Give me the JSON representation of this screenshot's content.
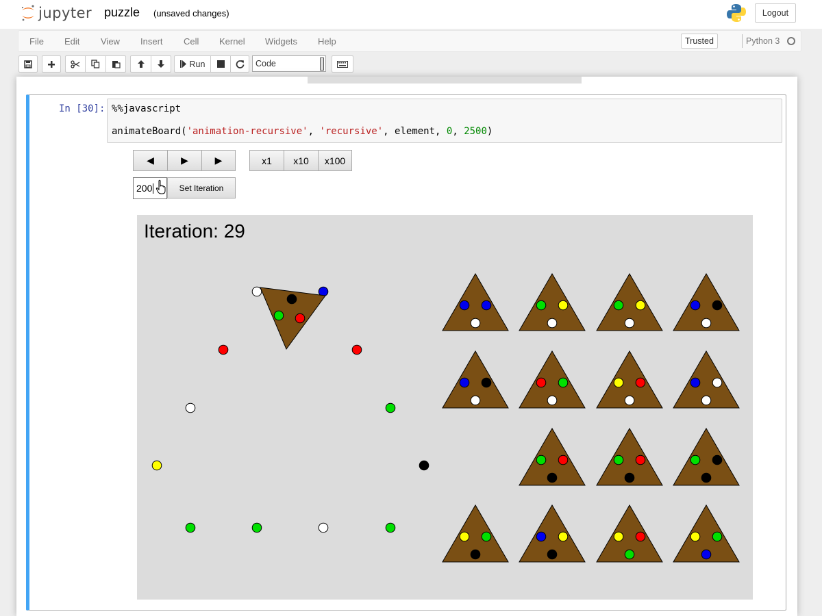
{
  "header": {
    "logo_text": "jupyter",
    "notebook_name": "puzzle",
    "save_status": "(unsaved changes)",
    "logout_label": "Logout"
  },
  "menubar": {
    "items": [
      "File",
      "Edit",
      "View",
      "Insert",
      "Cell",
      "Kernel",
      "Widgets",
      "Help"
    ],
    "trusted_label": "Trusted",
    "kernel_name": "Python 3"
  },
  "toolbar": {
    "icons": [
      "save-icon",
      "plus-icon",
      "cut-icon",
      "copy-icon",
      "paste-icon",
      "arrow-up-icon",
      "arrow-down-icon",
      "run-icon",
      "stop-icon",
      "restart-icon",
      "keyboard-icon"
    ],
    "run_label": "Run",
    "cell_type_value": "Code"
  },
  "cell": {
    "prompt": "In [30]:",
    "code_line_1": "%%javascript",
    "code_line_2_prefix": "animateBoard(",
    "code_arg_1": "'animation-recursive'",
    "code_sep": ", ",
    "code_arg_2": "'recursive'",
    "code_arg_3": "element",
    "code_arg_4": "0",
    "code_arg_5": "2500",
    "code_suffix": ")"
  },
  "controls": {
    "prev_label": "◀",
    "play_label": "▶",
    "next_label": "▶",
    "speed_1": "x1",
    "speed_10": "x10",
    "speed_100": "x100",
    "iteration_input_value": "200",
    "set_iteration_label": "Set Iteration"
  },
  "board": {
    "iteration_prefix": "Iteration: ",
    "iteration_value": "29",
    "colors": {
      "background": "#dcdcdc",
      "piece": "#7a4f14",
      "white": "#ffffff",
      "black": "#000000",
      "red": "#ff0000",
      "green": "#00e000",
      "blue": "#0000ee",
      "yellow": "#ffff00"
    },
    "loose_marbles": [
      "white",
      "blue",
      "red",
      "red",
      "white",
      "green",
      "yellow",
      "black",
      "green",
      "green",
      "white",
      "green"
    ],
    "moving_piece_marbles": [
      "black",
      "green",
      "red"
    ],
    "placed_pieces": [
      {
        "row": 1,
        "col": 1,
        "marbles": [
          "blue",
          "blue",
          "white"
        ]
      },
      {
        "row": 1,
        "col": 2,
        "marbles": [
          "green",
          "yellow",
          "white"
        ]
      },
      {
        "row": 1,
        "col": 3,
        "marbles": [
          "green",
          "yellow",
          "white"
        ]
      },
      {
        "row": 1,
        "col": 4,
        "marbles": [
          "blue",
          "black",
          "white"
        ]
      },
      {
        "row": 2,
        "col": 1,
        "marbles": [
          "blue",
          "black",
          "white"
        ]
      },
      {
        "row": 2,
        "col": 2,
        "marbles": [
          "red",
          "green",
          "white"
        ]
      },
      {
        "row": 2,
        "col": 3,
        "marbles": [
          "yellow",
          "red",
          "white"
        ]
      },
      {
        "row": 2,
        "col": 4,
        "marbles": [
          "blue",
          "white",
          "white"
        ]
      },
      {
        "row": 3,
        "col": 2,
        "marbles": [
          "green",
          "red",
          "black"
        ]
      },
      {
        "row": 3,
        "col": 3,
        "marbles": [
          "green",
          "red",
          "black"
        ]
      },
      {
        "row": 3,
        "col": 4,
        "marbles": [
          "green",
          "black",
          "black"
        ]
      },
      {
        "row": 4,
        "col": 1,
        "marbles": [
          "yellow",
          "green",
          "black"
        ]
      },
      {
        "row": 4,
        "col": 2,
        "marbles": [
          "blue",
          "yellow",
          "black"
        ]
      },
      {
        "row": 4,
        "col": 3,
        "marbles": [
          "yellow",
          "red",
          "green"
        ]
      },
      {
        "row": 4,
        "col": 4,
        "marbles": [
          "yellow",
          "green",
          "blue"
        ]
      }
    ]
  }
}
